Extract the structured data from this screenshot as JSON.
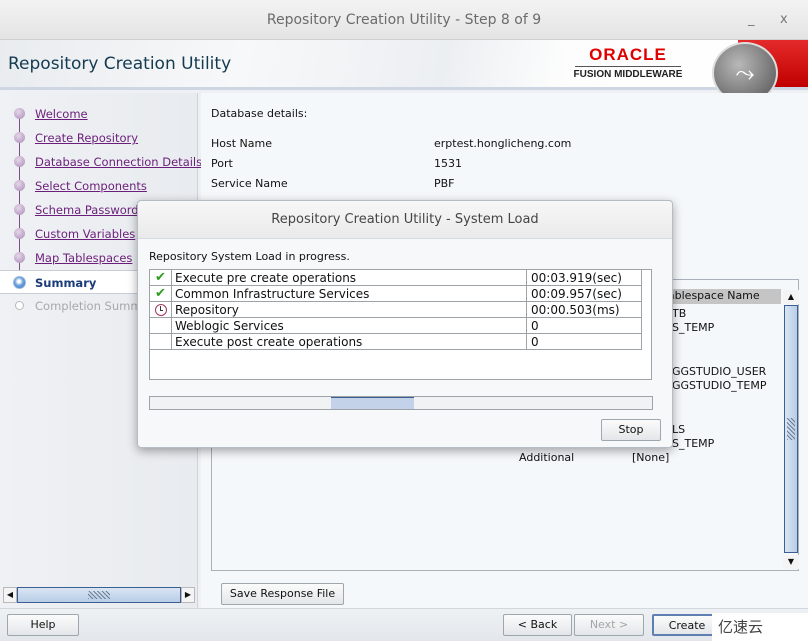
{
  "window": {
    "title": "Repository Creation Utility - Step 8 of 9",
    "minimize_label": "_",
    "close_label": "x"
  },
  "banner": {
    "app_title": "Repository Creation Utility",
    "logo_brand": "ORACLE",
    "logo_product": "FUSION MIDDLEWARE"
  },
  "sidebar": {
    "items": [
      {
        "label": "Welcome",
        "state": "done"
      },
      {
        "label": "Create Repository",
        "state": "done"
      },
      {
        "label": "Database Connection Details",
        "state": "done"
      },
      {
        "label": "Select Components",
        "state": "done"
      },
      {
        "label": "Schema Passwords",
        "state": "done"
      },
      {
        "label": "Custom Variables",
        "state": "done"
      },
      {
        "label": "Map Tablespaces",
        "state": "done"
      },
      {
        "label": "Summary",
        "state": "current"
      },
      {
        "label": "Completion Summary",
        "state": "disabled"
      }
    ]
  },
  "main": {
    "db_heading": "Database details:",
    "details": [
      {
        "key": "Host Name",
        "value": "erptest.honglicheng.com"
      },
      {
        "key": "Port",
        "value": "1531"
      },
      {
        "key": "Service Name",
        "value": "PBF"
      }
    ],
    "summary": {
      "column_header": "Tablespace Name",
      "visible_values": [
        "TB",
        "S_TEMP",
        "GGSTUDIO_USER",
        "GGSTUDIO_TEMP",
        "LS",
        "S_TEMP"
      ],
      "additional_label": "Additional",
      "additional_value": "[None]"
    },
    "save_response_button": "Save Response File"
  },
  "dialog": {
    "title": "Repository Creation Utility - System Load",
    "status": "Repository System Load in progress.",
    "tasks": [
      {
        "name": "Execute pre create operations",
        "time": "00:03.919(sec)",
        "status_icon": "check-icon"
      },
      {
        "name": "Common Infrastructure Services",
        "time": "00:09.957(sec)",
        "status_icon": "check-icon"
      },
      {
        "name": "Repository",
        "time": "00:00.503(ms)",
        "status_icon": "clock-icon"
      },
      {
        "name": "Weblogic Services",
        "time": "0",
        "status_icon": ""
      },
      {
        "name": "Execute post create operations",
        "time": "0",
        "status_icon": ""
      }
    ],
    "progress_indeterminate": true,
    "stop_button": "Stop"
  },
  "footer": {
    "help_button": "Help",
    "back_button": "< Back",
    "next_button": "Next >",
    "create_button": "Create"
  },
  "watermark": "亿速云"
}
